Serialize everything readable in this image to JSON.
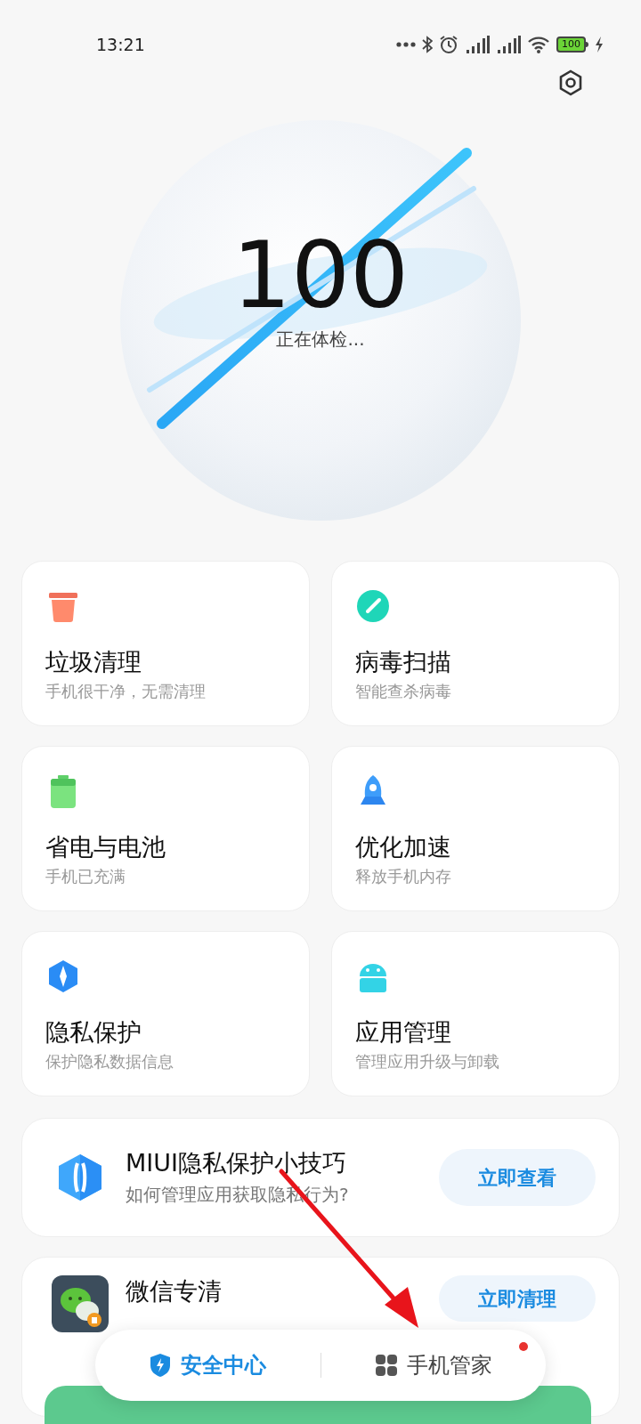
{
  "status_bar": {
    "time": "13:21",
    "battery": "100"
  },
  "score": {
    "value": "100",
    "caption": "正在体检..."
  },
  "features": [
    {
      "kind": "trash",
      "title": "垃圾清理",
      "subtitle": "手机很干净，无需清理"
    },
    {
      "kind": "scan",
      "title": "病毒扫描",
      "subtitle": "智能查杀病毒"
    },
    {
      "kind": "battery",
      "title": "省电与电池",
      "subtitle": "手机已充满"
    },
    {
      "kind": "rocket",
      "title": "优化加速",
      "subtitle": "释放手机内存"
    },
    {
      "kind": "privacy",
      "title": "隐私保护",
      "subtitle": "保护隐私数据信息"
    },
    {
      "kind": "android",
      "title": "应用管理",
      "subtitle": "管理应用升级与卸载"
    }
  ],
  "tips": [
    {
      "kind": "privacy",
      "title": "MIUI隐私保护小技巧",
      "subtitle": "如何管理应用获取隐私行为?",
      "button": "立即查看"
    },
    {
      "kind": "wechat",
      "title": "微信专清",
      "button": "立即清理"
    }
  ],
  "bottom_nav": [
    {
      "kind": "shield",
      "label": "安全中心",
      "selected": true,
      "badge": false
    },
    {
      "kind": "grid",
      "label": "手机管家",
      "selected": false,
      "badge": true
    }
  ]
}
